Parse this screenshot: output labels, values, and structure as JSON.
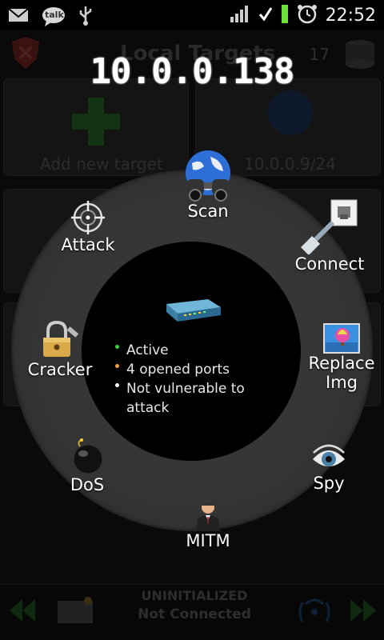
{
  "statusbar": {
    "time": "22:52",
    "left_icons": [
      "gmail-icon",
      "talk-icon",
      "usb-icon"
    ],
    "right_icons": [
      "signal-icon",
      "checkmark-icon",
      "battery-icon",
      "alarm-icon"
    ],
    "talk_label": "talk"
  },
  "background": {
    "title": "Local Targets",
    "count": "17",
    "tiles": [
      "Add new target",
      "10.0.0.9/24"
    ]
  },
  "overlay": {
    "target_ip": "10.0.0.138",
    "status": [
      {
        "text": "Active",
        "color": "#3bd23b"
      },
      {
        "text": "4 opened ports",
        "color": "#f2a23a"
      },
      {
        "text": "Not vulnerable to",
        "color": "#ffffff"
      },
      {
        "text": "attack",
        "color": ""
      }
    ],
    "menu": {
      "scan": "Scan",
      "attack": "Attack",
      "connect": "Connect",
      "cracker": "Cracker",
      "replace_img_1": "Replace",
      "replace_img_2": "Img",
      "dos": "DoS",
      "spy": "Spy",
      "mitm": "MITM"
    }
  },
  "bottom_bar": {
    "status_1": "UNINITIALIZED",
    "status_2": "Not Connected"
  }
}
